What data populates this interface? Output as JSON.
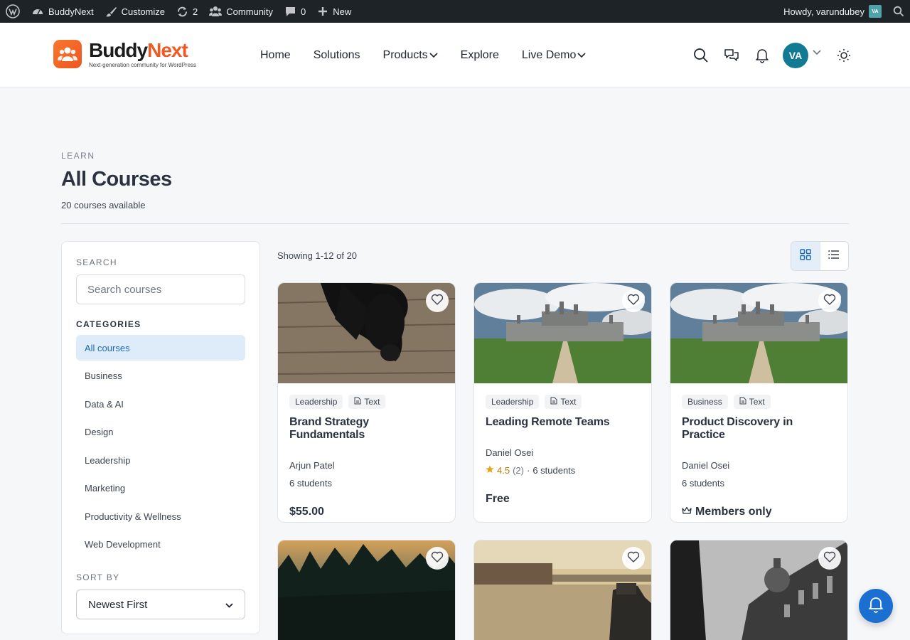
{
  "admin_bar": {
    "site_name": "BuddyNext",
    "customize": "Customize",
    "updates_count": "2",
    "community": "Community",
    "comments_count": "0",
    "new_label": "New",
    "greeting": "Howdy, varundubey",
    "avatar_initials": "VA"
  },
  "header": {
    "logo_part1": "Buddy",
    "logo_part2": "Next",
    "logo_tagline": "Next-generation community for WordPress",
    "nav": [
      {
        "label": "Home",
        "dropdown": false
      },
      {
        "label": "Solutions",
        "dropdown": false
      },
      {
        "label": "Products",
        "dropdown": true
      },
      {
        "label": "Explore",
        "dropdown": false
      },
      {
        "label": "Live Demo",
        "dropdown": true
      }
    ],
    "avatar_initials": "VA"
  },
  "page": {
    "eyebrow": "LEARN",
    "title": "All Courses",
    "subtitle": "20 courses available",
    "showing": "Showing 1-12 of 20"
  },
  "sidebar": {
    "search_label": "SEARCH",
    "search_placeholder": "Search courses",
    "categories_label": "CATEGORIES",
    "categories": [
      {
        "label": "All courses",
        "active": true
      },
      {
        "label": "Business",
        "active": false
      },
      {
        "label": "Data & AI",
        "active": false
      },
      {
        "label": "Design",
        "active": false
      },
      {
        "label": "Leadership",
        "active": false
      },
      {
        "label": "Marketing",
        "active": false
      },
      {
        "label": "Productivity & Wellness",
        "active": false
      },
      {
        "label": "Web Development",
        "active": false
      }
    ],
    "sort_label": "SORT BY",
    "sort_value": "Newest First"
  },
  "view_toggle": {
    "active": "grid"
  },
  "courses": [
    {
      "category": "Leadership",
      "type": "Text",
      "title": "Brand Strategy Fundamentals",
      "author": "Arjun Patel",
      "rating": "",
      "rating_count": "",
      "students": "6 students",
      "price": "$55.00",
      "members_only": false,
      "image": "dog"
    },
    {
      "category": "Leadership",
      "type": "Text",
      "title": "Leading Remote Teams",
      "author": "Daniel Osei",
      "rating": "4.5",
      "rating_count": "(2)",
      "students": "6 students",
      "price": "Free",
      "members_only": false,
      "image": "chateau"
    },
    {
      "category": "Business",
      "type": "Text",
      "title": "Product Discovery in Practice",
      "author": "Daniel Osei",
      "rating": "",
      "rating_count": "",
      "students": "6 students",
      "price": "Members only",
      "members_only": true,
      "image": "chateau"
    },
    {
      "image": "forest"
    },
    {
      "image": "harbor"
    },
    {
      "image": "street"
    }
  ],
  "colors": {
    "accent": "#1b6fd1",
    "brand_orange": "#ef5a24",
    "avatar_teal": "#137a94",
    "active_category_bg": "#deebf8",
    "active_category_text": "#1c6bb5",
    "rating_star": "#e8a317"
  },
  "icons": [
    "wordpress-icon",
    "dashboard-icon",
    "brush-icon",
    "refresh-icon",
    "community-icon",
    "comment-icon",
    "plus-icon",
    "search-icon",
    "chat-icon",
    "bell-icon",
    "sun-icon",
    "chevron-down-icon",
    "grid-icon",
    "list-icon",
    "heart-icon",
    "document-icon",
    "star-icon",
    "crown-icon"
  ]
}
